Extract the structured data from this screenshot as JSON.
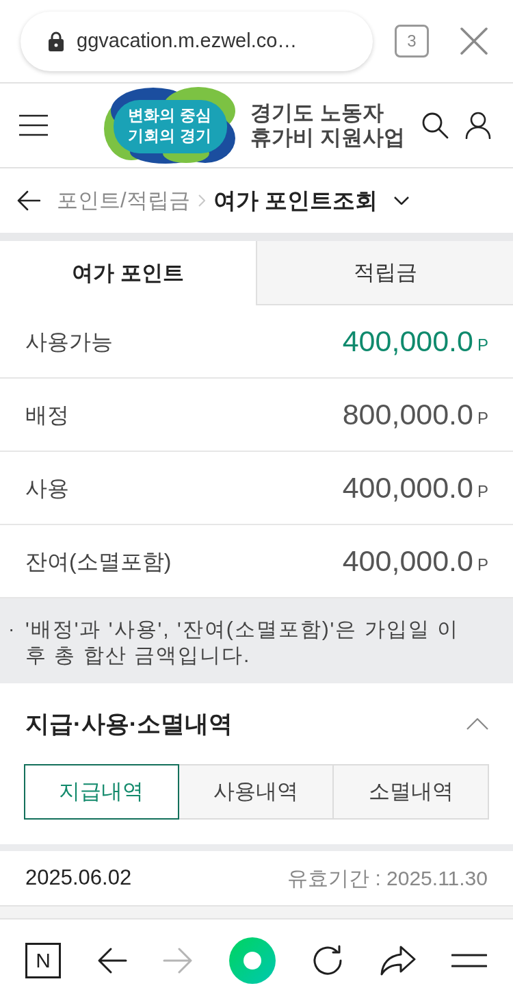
{
  "browser_bar": {
    "url": "ggvacation.m.ezwel.co…",
    "tab_count": "3"
  },
  "header": {
    "logo_lines": [
      "변화의 중심",
      "기회의 경기"
    ],
    "title_lines": [
      "경기도 노동자",
      "휴가비 지원사업"
    ]
  },
  "breadcrumb": {
    "parent": "포인트/적립금",
    "current": "여가 포인트조회"
  },
  "tabs": [
    {
      "label": "여가 포인트",
      "selected": true
    },
    {
      "label": "적립금",
      "selected": false
    }
  ],
  "summary_rows": [
    {
      "label": "사용가능",
      "value": "400,000.0",
      "unit": "P",
      "highlight": true
    },
    {
      "label": "배정",
      "value": "800,000.0",
      "unit": "P",
      "highlight": false
    },
    {
      "label": "사용",
      "value": "400,000.0",
      "unit": "P",
      "highlight": false
    },
    {
      "label": "잔여(소멸포함)",
      "value": "400,000.0",
      "unit": "P",
      "highlight": false
    }
  ],
  "notice": {
    "marker": "·",
    "text": "'배정'과 '사용', '잔여(소멸포함)'은 가입일 이후 총 합산 금액입니다."
  },
  "history": {
    "title": "지급·사용·소멸내역",
    "expanded": true,
    "tabs": [
      {
        "label": "지급내역",
        "selected": true
      },
      {
        "label": "사용내역",
        "selected": false
      },
      {
        "label": "소멸내역",
        "selected": false
      }
    ],
    "entries": [
      {
        "date": "2025.06.02",
        "expiry": "유효기간 : 2025.11.30"
      }
    ]
  },
  "bottom_toolbar": [
    {
      "kind": "home",
      "label": "N",
      "disabled": false
    },
    {
      "kind": "back",
      "disabled": false
    },
    {
      "kind": "forward",
      "disabled": true
    },
    {
      "kind": "green",
      "disabled": false
    },
    {
      "kind": "reload",
      "disabled": false
    },
    {
      "kind": "share",
      "disabled": false
    },
    {
      "kind": "menu",
      "disabled": false
    }
  ]
}
